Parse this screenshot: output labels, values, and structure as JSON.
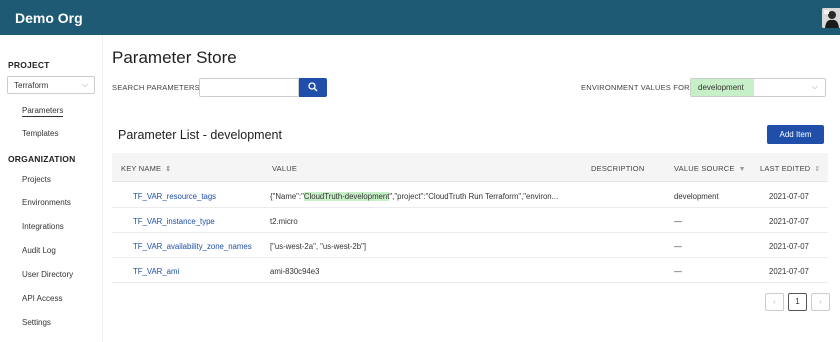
{
  "header": {
    "org_name": "Demo Org"
  },
  "sidebar": {
    "project_heading": "PROJECT",
    "project_value": "Terraform",
    "project_items": [
      "Parameters",
      "Templates"
    ],
    "organization_heading": "ORGANIZATION",
    "organization_items": [
      "Projects",
      "Environments",
      "Integrations",
      "Audit Log",
      "User Directory",
      "API Access",
      "Settings"
    ]
  },
  "main": {
    "title": "Parameter Store",
    "search_label": "SEARCH PARAMETERS:",
    "search_value": "",
    "env_label": "ENVIRONMENT VALUES FOR:",
    "env_value": "development",
    "list_title": "Parameter List - development",
    "add_button": "Add Item"
  },
  "table": {
    "columns": [
      "KEY NAME",
      "VALUE",
      "DESCRIPTION",
      "VALUE SOURCE",
      "LAST EDITED"
    ],
    "rows": [
      {
        "key": "TF_VAR_resource_tags",
        "value_pre": "{\"Name\":\"",
        "value_hl": "CloudTruth-development",
        "value_post": "\",\"project\":\"CloudTruth Run Terraform\",\"environ...",
        "description": "",
        "source": "development",
        "edited": "2021-07-07"
      },
      {
        "key": "TF_VAR_instance_type",
        "value_pre": "t2.micro",
        "value_hl": "",
        "value_post": "",
        "description": "",
        "source": "—",
        "edited": "2021-07-07"
      },
      {
        "key": "TF_VAR_availability_zone_names",
        "value_pre": "[\"us-west-2a\", \"us-west-2b\"]",
        "value_hl": "",
        "value_post": "",
        "description": "",
        "source": "—",
        "edited": "2021-07-07"
      },
      {
        "key": "TF_VAR_ami",
        "value_pre": "ami-830c94e3",
        "value_hl": "",
        "value_post": "",
        "description": "",
        "source": "—",
        "edited": "2021-07-07"
      }
    ]
  },
  "pagination": {
    "prev": "‹",
    "current": "1",
    "next": "›"
  },
  "icons": {
    "search": "search-icon",
    "sort": "sort-icon",
    "filter": "filter-icon",
    "chevron": "chevron-down-icon"
  },
  "colors": {
    "header_bg": "#1e5a73",
    "accent": "#1f4fa8",
    "env_highlight": "#c8f0c8",
    "link": "#1f4fa8"
  }
}
